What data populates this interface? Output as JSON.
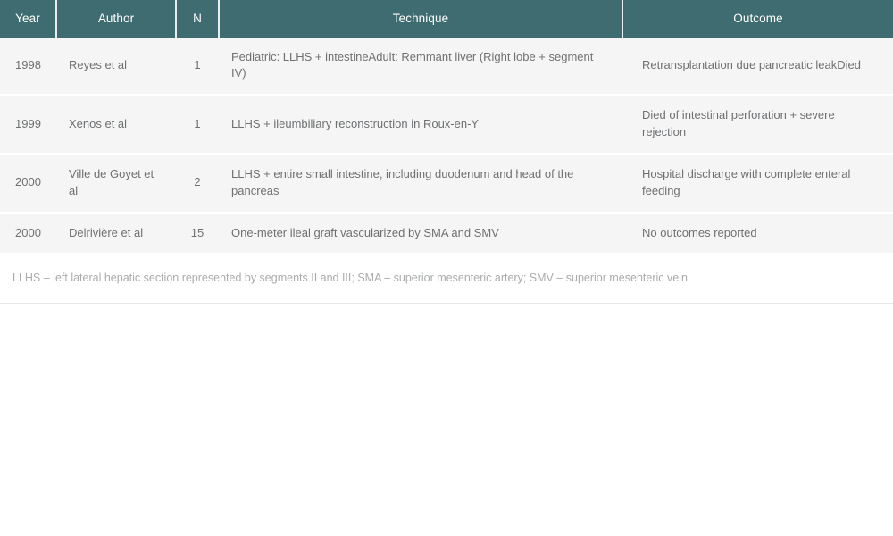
{
  "table": {
    "columns": [
      {
        "key": "year",
        "label": "Year"
      },
      {
        "key": "author",
        "label": "Author"
      },
      {
        "key": "n",
        "label": "N"
      },
      {
        "key": "technique",
        "label": "Technique"
      },
      {
        "key": "outcome",
        "label": "Outcome"
      }
    ],
    "rows": [
      {
        "year": "1998",
        "author": "Reyes et al",
        "n": "1",
        "technique": "Pediatric: LLHS + intestineAdult: Remmant liver (Right lobe + segment IV)",
        "outcome": "Retransplantation due pancreatic leakDied"
      },
      {
        "year": "1999",
        "author": "Xenos et al",
        "n": "1",
        "technique": "LLHS + ileumbiliary reconstruction in Roux-en-Y",
        "outcome": "Died of intestinal perforation + severe rejection"
      },
      {
        "year": "2000",
        "author": "Ville de Goyet et al",
        "n": "2",
        "technique": "LLHS + entire small intestine, including duodenum and head of the pancreas",
        "outcome": "Hospital discharge with complete enteral feeding"
      },
      {
        "year": "2000",
        "author": "Delrivière et al",
        "n": "15",
        "technique": "One-meter ileal graft vascularized by SMA and SMV",
        "outcome": "No outcomes reported"
      }
    ],
    "footnote": "LLHS – left lateral hepatic section represented by segments II and III; SMA – superior mesenteric artery; SMV – superior mesenteric vein."
  },
  "colors": {
    "header_background": "#3f6c70",
    "header_text": "#ffffff",
    "row_background": "#f5f5f5",
    "row_text": "#6e7072",
    "footnote_text": "#a9abad",
    "page_background": "#ffffff"
  }
}
